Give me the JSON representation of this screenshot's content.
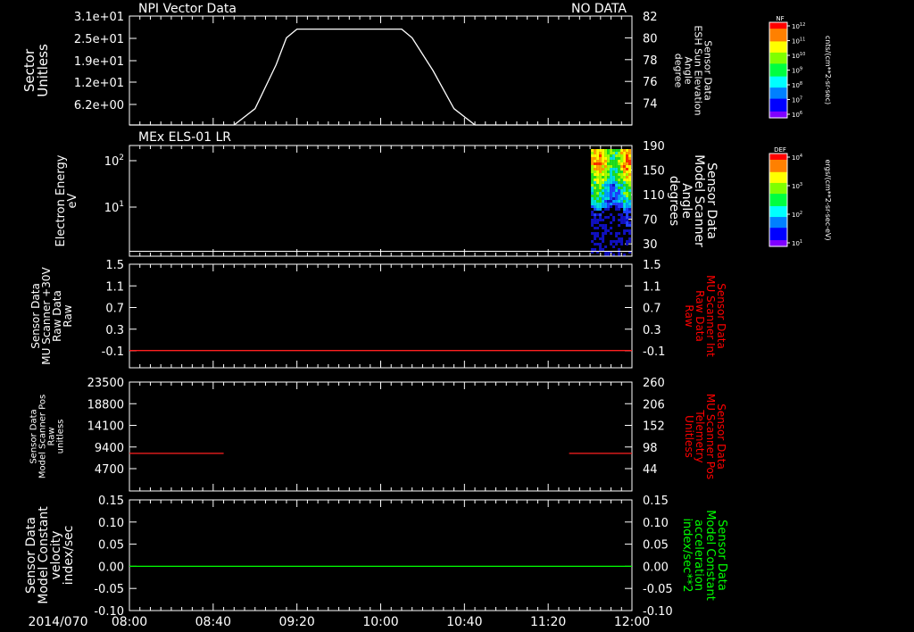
{
  "chart_data": [
    {
      "type": "line",
      "title": "NPI Vector Data",
      "status": "NO DATA",
      "left_label": [
        "Sector",
        "Unitless"
      ],
      "left_ticks": [
        "3.1e+01",
        "2.5e+01",
        "1.9e+01",
        "1.2e+01",
        "6.2e+00"
      ],
      "right_label": [
        "Sensor Data",
        "ESH Sun Elevation",
        "Angle",
        "degree"
      ],
      "right_ticks": [
        82,
        80,
        78,
        76,
        74
      ],
      "right_ylim": [
        72,
        82
      ],
      "series": [
        {
          "color": "#ffffff",
          "x": [
            "08:00",
            "08:50",
            "09:00",
            "09:10",
            "09:15",
            "09:20",
            "09:40",
            "10:10",
            "10:15",
            "10:25",
            "10:35",
            "10:45",
            "12:00"
          ],
          "y": [
            72.0,
            72.0,
            73.5,
            77.5,
            80.0,
            80.8,
            80.8,
            80.8,
            80.0,
            77.0,
            73.5,
            72.0,
            72.0
          ]
        }
      ]
    },
    {
      "type": "heatmap",
      "title": "MEx ELS-01 LR",
      "left_label": [
        "Electron Energy",
        "eV"
      ],
      "left_ticks": [
        "10^2",
        "10^1"
      ],
      "right_label": [
        "Sensor Data",
        "Model Scanner",
        "Angle",
        "degrees"
      ],
      "right_ticks": [
        190,
        150,
        110,
        70,
        30
      ],
      "right_ylim": [
        10,
        190
      ],
      "data_interval": [
        "11:40",
        "12:00"
      ],
      "baseline_angle": 18
    },
    {
      "type": "line",
      "left_label": [
        "Sensor Data",
        "MU Scanner +30V",
        "Raw Data",
        "Raw"
      ],
      "left_ticks": [
        "1.5",
        "1.1",
        "0.7",
        "0.3",
        "-0.1"
      ],
      "ylim": [
        -0.3,
        1.5
      ],
      "right_label": [
        "Sensor Data",
        "MU Scanner Int",
        "Raw Data",
        "Raw"
      ],
      "right_ticks": [
        "1.5",
        "1.1",
        "0.7",
        "0.3",
        "-0.1"
      ],
      "right_color": "#ff0000",
      "series": [
        {
          "color": "#ff2020",
          "x": [
            "08:00",
            "12:00"
          ],
          "y": [
            0.0,
            0.0
          ]
        }
      ]
    },
    {
      "type": "line",
      "left_label": [
        "Sensor Data",
        "Model Scanner Pos",
        "Raw",
        "unitless"
      ],
      "left_ticks": [
        "23500",
        "18800",
        "14100",
        "9400",
        "4700"
      ],
      "ylim": [
        0,
        23500
      ],
      "right_label": [
        "Sensor Data",
        "MU Scanner Pos",
        "Telemetry",
        "Unitless"
      ],
      "right_ticks": [
        260,
        206,
        152,
        98,
        44
      ],
      "right_ylim": [
        0,
        260
      ],
      "right_color": "#ff0000",
      "series": [
        {
          "color": "#ff2020",
          "x": [
            "08:00",
            "08:45"
          ],
          "y": [
            8100,
            8100
          ]
        },
        {
          "color": "#ff2020",
          "x": [
            "11:30",
            "12:00"
          ],
          "y": [
            8100,
            8100
          ]
        }
      ]
    },
    {
      "type": "line",
      "left_label": [
        "Sensor Data",
        "Model Constant",
        "velocity",
        "index/sec"
      ],
      "left_ticks": [
        "0.15",
        "0.10",
        "0.05",
        "0.00",
        "-0.05",
        "-0.10"
      ],
      "ylim": [
        -0.1,
        0.15
      ],
      "right_label": [
        "Sensor Data",
        "Model Constant",
        "acceleration",
        "index/sec**2"
      ],
      "right_ticks": [
        "0.15",
        "0.10",
        "0.05",
        "0.00",
        "-0.05",
        "-0.10"
      ],
      "right_color": "#00ff00",
      "series": [
        {
          "color": "#00ff00",
          "x": [
            "08:00",
            "12:00"
          ],
          "y": [
            0.0,
            0.0
          ]
        }
      ]
    }
  ],
  "time_axis": {
    "date": "2014/070",
    "ticks": [
      "08:00",
      "08:40",
      "09:20",
      "10:00",
      "10:40",
      "11:20",
      "12:00"
    ],
    "range": [
      "08:00",
      "12:00"
    ]
  },
  "colorbars": [
    {
      "name": "NF",
      "unit": "cnts/(cm**2-sr-sec)",
      "ticks": [
        "10^12",
        "10^11",
        "10^10",
        "10^9",
        "10^8",
        "10^7",
        "10^6"
      ]
    },
    {
      "name": "DEF",
      "unit": "ergs/(cm**2-sr-sec-eV)",
      "ticks": [
        "10^4",
        "10^3",
        "10^2",
        "10^1"
      ]
    }
  ]
}
